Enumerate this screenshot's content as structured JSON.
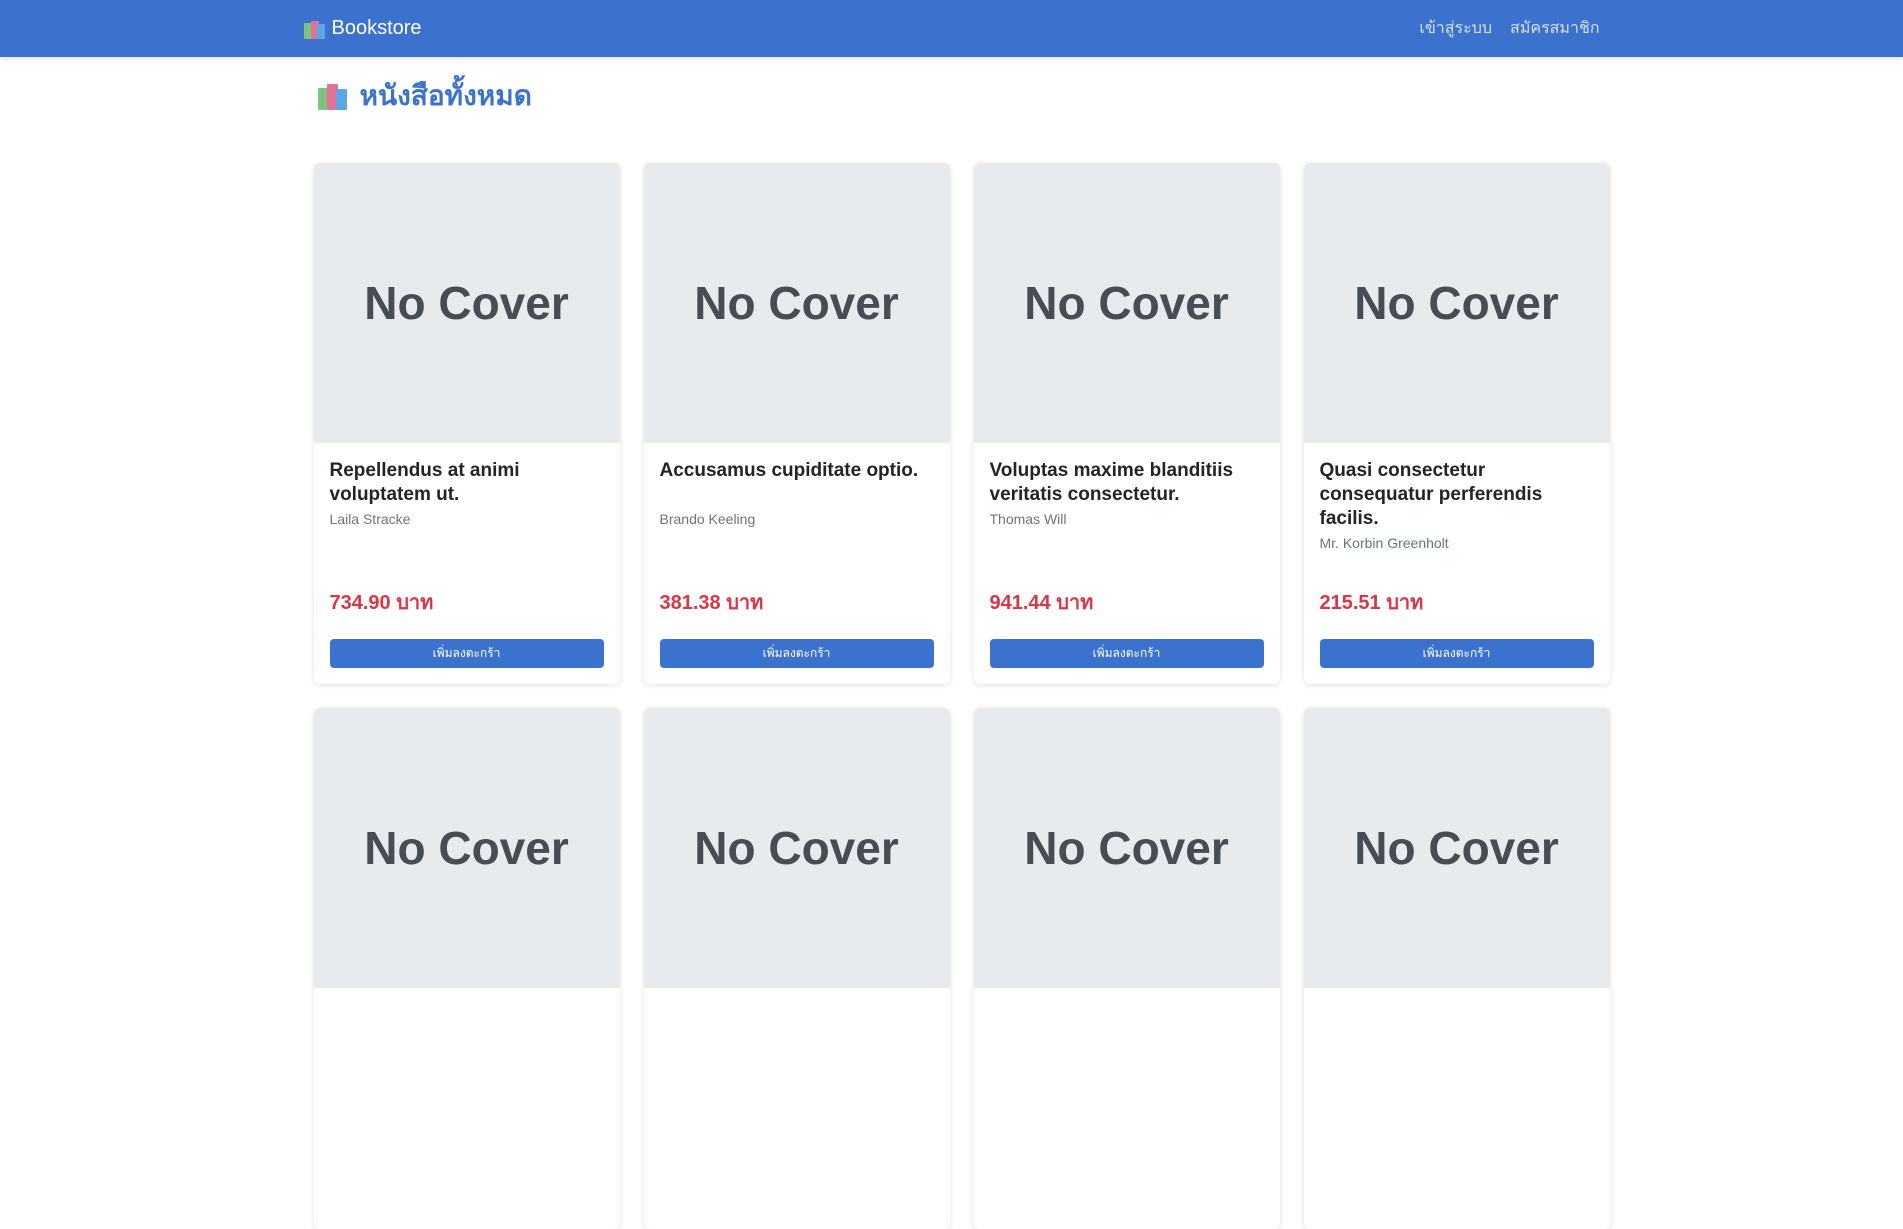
{
  "navbar": {
    "brand": "Bookstore",
    "links": [
      "เข้าสู่ระบบ",
      "สมัครสมาชิก"
    ]
  },
  "page": {
    "title": "หนังสือทั้งหมด"
  },
  "books": [
    {
      "cover": "No Cover",
      "title": "Repellendus at animi voluptatem ut.",
      "author": "Laila Stracke",
      "price": "734.90 บาท",
      "button": "เพิ่มลงตะกร้า"
    },
    {
      "cover": "No Cover",
      "title": "Accusamus cupiditate optio.",
      "author": "Brando Keeling",
      "price": "381.38 บาท",
      "button": "เพิ่มลงตะกร้า"
    },
    {
      "cover": "No Cover",
      "title": "Voluptas maxime blanditiis veritatis consectetur.",
      "author": "Thomas Will",
      "price": "941.44 บาท",
      "button": "เพิ่มลงตะกร้า"
    },
    {
      "cover": "No Cover",
      "title": "Quasi consectetur consequatur perferendis facilis.",
      "author": "Mr. Korbin Greenholt",
      "price": "215.51 บาท",
      "button": "เพิ่มลงตะกร้า"
    },
    {
      "cover": "No Cover"
    },
    {
      "cover": "No Cover"
    },
    {
      "cover": "No Cover"
    },
    {
      "cover": "No Cover"
    }
  ],
  "colors": {
    "primary": "#3b72cd",
    "price": "#dc3545",
    "cover_bg": "#e8ebee"
  }
}
